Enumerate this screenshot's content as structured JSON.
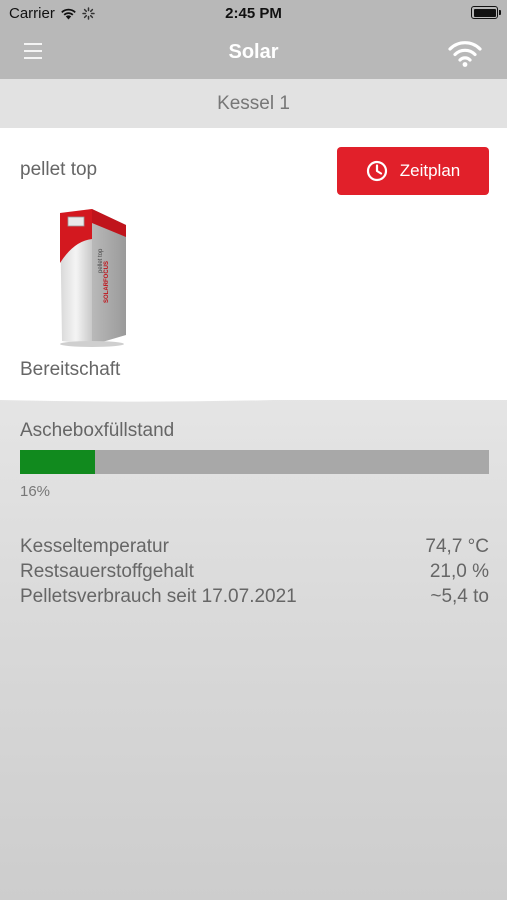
{
  "status_bar": {
    "carrier": "Carrier",
    "time": "2:45 PM"
  },
  "nav": {
    "title": "Solar",
    "menu_icon": "hamburger-menu-icon",
    "connection_icon": "wifi-icon"
  },
  "section": {
    "title": "Kessel 1"
  },
  "boiler": {
    "model": "pellet top",
    "schedule_button": "Zeitplan",
    "status": "Bereitschaft"
  },
  "ash_box": {
    "label": "Ascheboxfüllstand",
    "percent_text": "16%",
    "fill_fraction": 0.16
  },
  "stats": [
    {
      "label": "Kesseltemperatur",
      "value": "74,7 °C"
    },
    {
      "label": "Restsauerstoffgehalt",
      "value": "21,0 %"
    },
    {
      "label": "Pelletsverbrauch seit 17.07.2021",
      "value": "~5,4 to"
    }
  ],
  "colors": {
    "accent_red": "#e1202a",
    "progress_green": "#118a1e",
    "nav_gray": "#b8b8b8"
  }
}
